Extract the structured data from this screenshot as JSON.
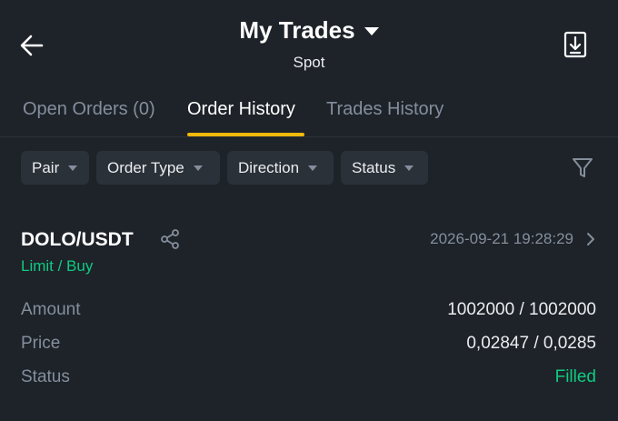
{
  "header": {
    "title": "My Trades",
    "subtitle": "Spot"
  },
  "tabs": [
    {
      "label": "Open Orders (0)",
      "active": false
    },
    {
      "label": "Order History",
      "active": true
    },
    {
      "label": "Trades History",
      "active": false
    }
  ],
  "filters": [
    {
      "label": "Pair"
    },
    {
      "label": "Order Type"
    },
    {
      "label": "Direction"
    },
    {
      "label": "Status"
    }
  ],
  "order": {
    "pair": "DOLO/USDT",
    "datetime": "2026-09-21 19:28:29",
    "side": "Limit / Buy",
    "rows": [
      {
        "label": "Amount",
        "value": "1002000 / 1002000"
      },
      {
        "label": "Price",
        "value": "0,02847 / 0,0285"
      },
      {
        "label": "Status",
        "value": "Filled"
      }
    ]
  },
  "colors": {
    "background": "#1e2329",
    "accent": "#f0b90b",
    "positive": "#0ecb81",
    "muted": "#848e9c"
  },
  "icons": [
    "back-arrow-icon",
    "caret-down-icon",
    "download-icon",
    "chevron-down-icon",
    "filter-icon",
    "share-icon",
    "chevron-right-icon"
  ]
}
